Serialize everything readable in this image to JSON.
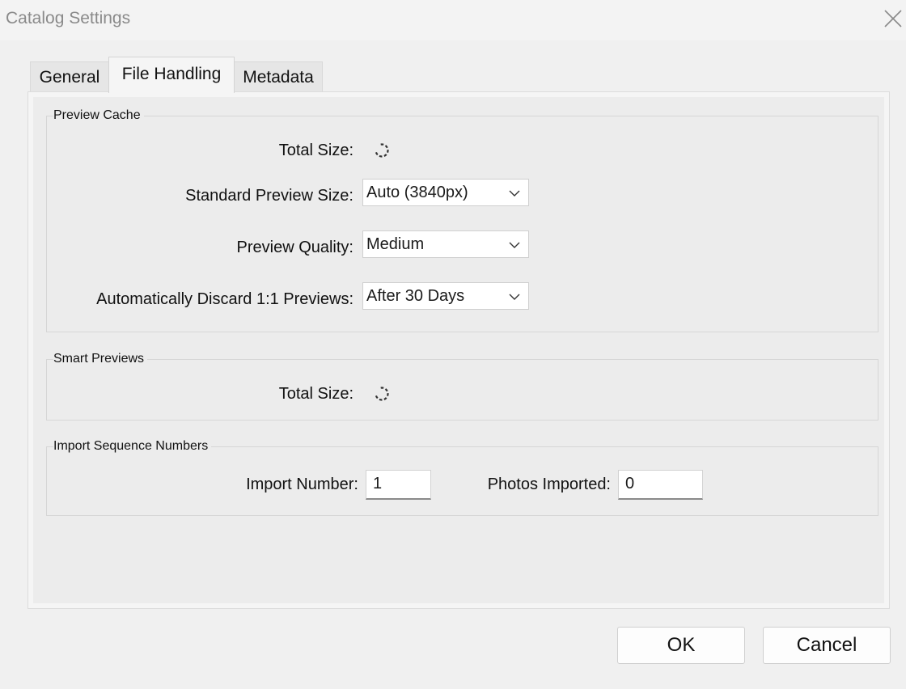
{
  "window": {
    "title": "Catalog Settings",
    "close_icon": "close-icon"
  },
  "tabs": [
    {
      "label": "General"
    },
    {
      "label": "File Handling",
      "active": true
    },
    {
      "label": "Metadata"
    }
  ],
  "preview_cache": {
    "legend": "Preview Cache",
    "total_size_label": "Total Size:",
    "standard_preview_size": {
      "label": "Standard Preview Size:",
      "value": "Auto (3840px)"
    },
    "preview_quality": {
      "label": "Preview Quality:",
      "value": "Medium"
    },
    "auto_discard": {
      "label": "Automatically Discard 1:1 Previews:",
      "value": "After 30 Days"
    }
  },
  "smart_previews": {
    "legend": "Smart Previews",
    "total_size_label": "Total Size:"
  },
  "import_sequence": {
    "legend": "Import Sequence Numbers",
    "import_number": {
      "label": "Import Number:",
      "value": "1"
    },
    "photos_imported": {
      "label": "Photos Imported:",
      "value": "0"
    }
  },
  "buttons": {
    "ok": "OK",
    "cancel": "Cancel"
  },
  "colors": {
    "window_bg": "#f0f0f0",
    "title_text": "#8a8a8a",
    "field_bg": "#ffffff"
  }
}
